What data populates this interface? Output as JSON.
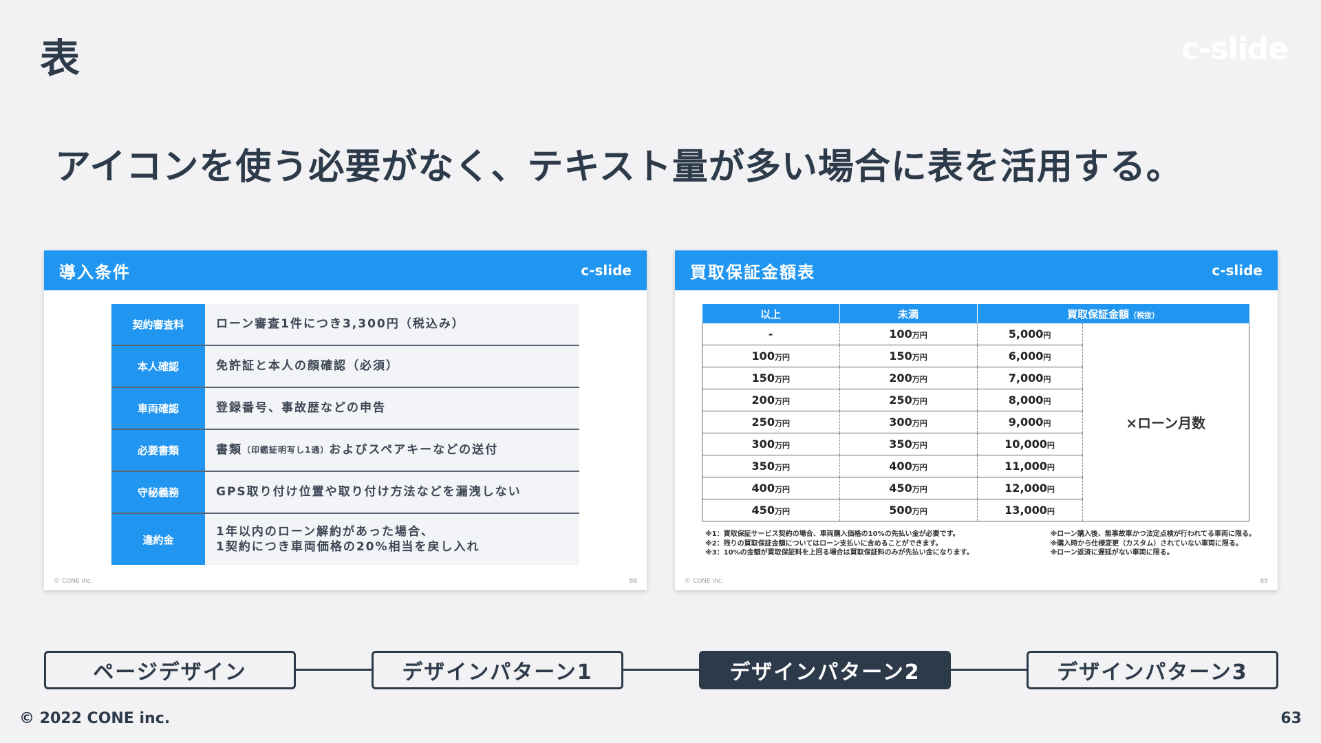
{
  "page": {
    "section_title": "表",
    "brand": "c-slide",
    "headline": "アイコンを使う必要がなく、テキスト量が多い場合に表を活用する。",
    "copyright": "© 2022 CONE inc.",
    "page_number": "63"
  },
  "slide_left": {
    "title": "導入条件",
    "brand": "c-slide",
    "footer_left": "© CONE inc.",
    "footer_right": "88",
    "rows": [
      {
        "label": "契約審査料",
        "value": "ローン審査1件につき3,300円（税込み）"
      },
      {
        "label": "本人確認",
        "value": "免許証と本人の顔確認（必須）"
      },
      {
        "label": "車両確認",
        "value": "登録番号、事故歴などの申告"
      },
      {
        "label": "必要書類",
        "value_a": "書類",
        "value_small": "（印鑑証明写し1通）",
        "value_b": "およびスペアキーなどの送付"
      },
      {
        "label": "守秘義務",
        "value": "GPS取り付け位置や取り付け方法などを漏洩しない"
      },
      {
        "label": "違約金",
        "value_line1": "1年以内のローン解約があった場合、",
        "value_line2": "1契約につき車両価格の20%相当を戻し入れ"
      }
    ]
  },
  "slide_right": {
    "title": "買取保証金額表",
    "brand": "c-slide",
    "footer_left": "© CONE inc.",
    "footer_right": "89",
    "headers": {
      "col1": "以上",
      "col2": "未満",
      "col3": "買取保証金額",
      "col3_note": "（税抜）"
    },
    "unit_man_yen": "万円",
    "unit_yen": "円",
    "multiplier": "×ローン月数",
    "rows": [
      {
        "min": "-",
        "max": "100",
        "amount": "5,000"
      },
      {
        "min": "100",
        "max": "150",
        "amount": "6,000"
      },
      {
        "min": "150",
        "max": "200",
        "amount": "7,000"
      },
      {
        "min": "200",
        "max": "250",
        "amount": "8,000"
      },
      {
        "min": "250",
        "max": "300",
        "amount": "9,000"
      },
      {
        "min": "300",
        "max": "350",
        "amount": "10,000"
      },
      {
        "min": "350",
        "max": "400",
        "amount": "11,000"
      },
      {
        "min": "400",
        "max": "450",
        "amount": "12,000"
      },
      {
        "min": "450",
        "max": "500",
        "amount": "13,000"
      }
    ],
    "notes_left": [
      "※1：買取保証サービス契約の場合、車両購入価格の10%の先払い金が必要です。",
      "※2：残りの買取保証金額についてはローン支払いに含めることができます。",
      "※3：10%の金額が買取保証料を上回る場合は買取保証料のみが先払い金になります。"
    ],
    "notes_right": [
      "※ローン購入後、無事故車かつ法定点検が行われてる車両に限る。",
      "※購入時から仕様変更（カスタム）されていない車両に限る。",
      "※ローン返済に遅延がない車両に限る。"
    ]
  },
  "flow": {
    "items": [
      {
        "label": "ページデザイン",
        "active": false
      },
      {
        "label": "デザインパターン1",
        "active": false
      },
      {
        "label": "デザインパターン2",
        "active": true
      },
      {
        "label": "デザインパターン3",
        "active": false
      }
    ]
  }
}
